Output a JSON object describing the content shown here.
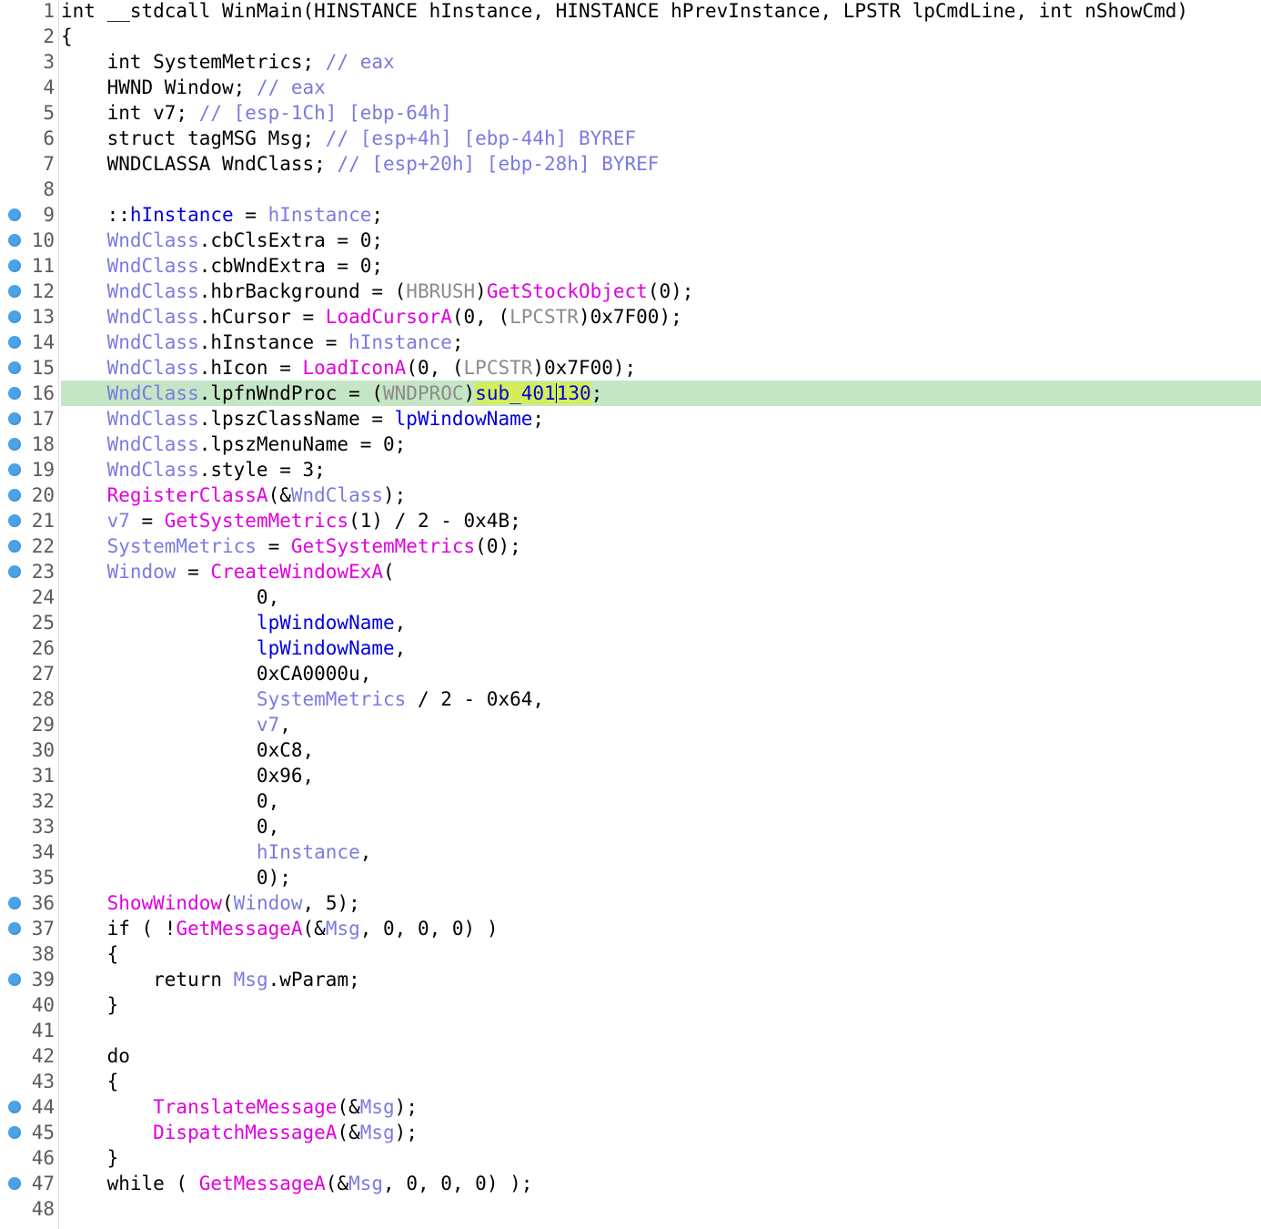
{
  "editor": {
    "view": "pseudocode",
    "highlighted_line": 16,
    "colors": {
      "highlight_line": "#c5e6c5",
      "selection": "#d4ee5a",
      "breakpoint": "#4aa3e8",
      "function": "#e000e0",
      "global": "#0000e0",
      "local": "#7b7be0",
      "type": "#8b8b8b",
      "comment": "#7a7adf"
    }
  },
  "lines": [
    {
      "n": "1",
      "bp": false,
      "hl": false,
      "tokens": [
        [
          "k",
          "int __stdcall WinMain(HINSTANCE hInstance, HINSTANCE hPrevInstance, LPSTR lpCmdLine, int nShowCmd)"
        ]
      ]
    },
    {
      "n": "2",
      "bp": false,
      "hl": false,
      "tokens": [
        [
          "p",
          "{"
        ]
      ]
    },
    {
      "n": "3",
      "bp": false,
      "hl": false,
      "tokens": [
        [
          "k",
          "    int SystemMetrics; "
        ],
        [
          "c",
          "// eax"
        ]
      ]
    },
    {
      "n": "4",
      "bp": false,
      "hl": false,
      "tokens": [
        [
          "k",
          "    HWND Window; "
        ],
        [
          "c",
          "// eax"
        ]
      ]
    },
    {
      "n": "5",
      "bp": false,
      "hl": false,
      "tokens": [
        [
          "k",
          "    int v7; "
        ],
        [
          "c",
          "// [esp-1Ch] [ebp-64h]"
        ]
      ]
    },
    {
      "n": "6",
      "bp": false,
      "hl": false,
      "tokens": [
        [
          "k",
          "    struct tagMSG Msg; "
        ],
        [
          "c",
          "// [esp+4h] [ebp-44h] BYREF"
        ]
      ]
    },
    {
      "n": "7",
      "bp": false,
      "hl": false,
      "tokens": [
        [
          "k",
          "    WNDCLASSA WndClass; "
        ],
        [
          "c",
          "// [esp+20h] [ebp-28h] BYREF"
        ]
      ]
    },
    {
      "n": "8",
      "bp": false,
      "hl": false,
      "tokens": []
    },
    {
      "n": "9",
      "bp": true,
      "hl": false,
      "tokens": [
        [
          "p",
          "    ::"
        ],
        [
          "g",
          "hInstance"
        ],
        [
          "p",
          " = "
        ],
        [
          "v",
          "hInstance"
        ],
        [
          "p",
          ";"
        ]
      ]
    },
    {
      "n": "10",
      "bp": true,
      "hl": false,
      "tokens": [
        [
          "v",
          "    WndClass"
        ],
        [
          "p",
          ".cbClsExtra = 0;"
        ]
      ]
    },
    {
      "n": "11",
      "bp": true,
      "hl": false,
      "tokens": [
        [
          "v",
          "    WndClass"
        ],
        [
          "p",
          ".cbWndExtra = 0;"
        ]
      ]
    },
    {
      "n": "12",
      "bp": true,
      "hl": false,
      "tokens": [
        [
          "v",
          "    WndClass"
        ],
        [
          "p",
          ".hbrBackground = ("
        ],
        [
          "t",
          "HBRUSH"
        ],
        [
          "p",
          ")"
        ],
        [
          "f",
          "GetStockObject"
        ],
        [
          "p",
          "(0);"
        ]
      ]
    },
    {
      "n": "13",
      "bp": true,
      "hl": false,
      "tokens": [
        [
          "v",
          "    WndClass"
        ],
        [
          "p",
          ".hCursor = "
        ],
        [
          "f",
          "LoadCursorA"
        ],
        [
          "p",
          "(0, ("
        ],
        [
          "t",
          "LPCSTR"
        ],
        [
          "p",
          ")0x7F00);"
        ]
      ]
    },
    {
      "n": "14",
      "bp": true,
      "hl": false,
      "tokens": [
        [
          "v",
          "    WndClass"
        ],
        [
          "p",
          ".hInstance = "
        ],
        [
          "v",
          "hInstance"
        ],
        [
          "p",
          ";"
        ]
      ]
    },
    {
      "n": "15",
      "bp": true,
      "hl": false,
      "tokens": [
        [
          "v",
          "    WndClass"
        ],
        [
          "p",
          ".hIcon = "
        ],
        [
          "f",
          "LoadIconA"
        ],
        [
          "p",
          "(0, ("
        ],
        [
          "t",
          "LPCSTR"
        ],
        [
          "p",
          ")0x7F00);"
        ]
      ]
    },
    {
      "n": "16",
      "bp": true,
      "hl": true,
      "tokens": [
        [
          "v",
          "    WndClass"
        ],
        [
          "p",
          ".lpfnWndProc = ("
        ],
        [
          "t",
          "WNDPROC"
        ],
        [
          "p",
          ")"
        ],
        [
          "gs",
          "sub_401"
        ],
        [
          "caret",
          ""
        ],
        [
          "gs",
          "130"
        ],
        [
          "p",
          ";"
        ]
      ]
    },
    {
      "n": "17",
      "bp": true,
      "hl": false,
      "tokens": [
        [
          "v",
          "    WndClass"
        ],
        [
          "p",
          ".lpszClassName = "
        ],
        [
          "g",
          "lpWindowName"
        ],
        [
          "p",
          ";"
        ]
      ]
    },
    {
      "n": "18",
      "bp": true,
      "hl": false,
      "tokens": [
        [
          "v",
          "    WndClass"
        ],
        [
          "p",
          ".lpszMenuName = 0;"
        ]
      ]
    },
    {
      "n": "19",
      "bp": true,
      "hl": false,
      "tokens": [
        [
          "v",
          "    WndClass"
        ],
        [
          "p",
          ".style = 3;"
        ]
      ]
    },
    {
      "n": "20",
      "bp": true,
      "hl": false,
      "tokens": [
        [
          "f",
          "    RegisterClassA"
        ],
        [
          "p",
          "(&"
        ],
        [
          "v",
          "WndClass"
        ],
        [
          "p",
          ");"
        ]
      ]
    },
    {
      "n": "21",
      "bp": true,
      "hl": false,
      "tokens": [
        [
          "v",
          "    v7"
        ],
        [
          "p",
          " = "
        ],
        [
          "f",
          "GetSystemMetrics"
        ],
        [
          "p",
          "(1) / 2 - 0x4B;"
        ]
      ]
    },
    {
      "n": "22",
      "bp": true,
      "hl": false,
      "tokens": [
        [
          "v",
          "    SystemMetrics"
        ],
        [
          "p",
          " = "
        ],
        [
          "f",
          "GetSystemMetrics"
        ],
        [
          "p",
          "(0);"
        ]
      ]
    },
    {
      "n": "23",
      "bp": true,
      "hl": false,
      "tokens": [
        [
          "v",
          "    Window"
        ],
        [
          "p",
          " = "
        ],
        [
          "f",
          "CreateWindowExA"
        ],
        [
          "p",
          "("
        ]
      ]
    },
    {
      "n": "24",
      "bp": false,
      "hl": false,
      "tokens": [
        [
          "p",
          "                 0,"
        ]
      ]
    },
    {
      "n": "25",
      "bp": false,
      "hl": false,
      "tokens": [
        [
          "g",
          "                 lpWindowName"
        ],
        [
          "p",
          ","
        ]
      ]
    },
    {
      "n": "26",
      "bp": false,
      "hl": false,
      "tokens": [
        [
          "g",
          "                 lpWindowName"
        ],
        [
          "p",
          ","
        ]
      ]
    },
    {
      "n": "27",
      "bp": false,
      "hl": false,
      "tokens": [
        [
          "p",
          "                 0xCA0000u,"
        ]
      ]
    },
    {
      "n": "28",
      "bp": false,
      "hl": false,
      "tokens": [
        [
          "v",
          "                 SystemMetrics"
        ],
        [
          "p",
          " / 2 - 0x64,"
        ]
      ]
    },
    {
      "n": "29",
      "bp": false,
      "hl": false,
      "tokens": [
        [
          "v",
          "                 v7"
        ],
        [
          "p",
          ","
        ]
      ]
    },
    {
      "n": "30",
      "bp": false,
      "hl": false,
      "tokens": [
        [
          "p",
          "                 0xC8,"
        ]
      ]
    },
    {
      "n": "31",
      "bp": false,
      "hl": false,
      "tokens": [
        [
          "p",
          "                 0x96,"
        ]
      ]
    },
    {
      "n": "32",
      "bp": false,
      "hl": false,
      "tokens": [
        [
          "p",
          "                 0,"
        ]
      ]
    },
    {
      "n": "33",
      "bp": false,
      "hl": false,
      "tokens": [
        [
          "p",
          "                 0,"
        ]
      ]
    },
    {
      "n": "34",
      "bp": false,
      "hl": false,
      "tokens": [
        [
          "v",
          "                 hInstance"
        ],
        [
          "p",
          ","
        ]
      ]
    },
    {
      "n": "35",
      "bp": false,
      "hl": false,
      "tokens": [
        [
          "p",
          "                 0);"
        ]
      ]
    },
    {
      "n": "36",
      "bp": true,
      "hl": false,
      "tokens": [
        [
          "f",
          "    ShowWindow"
        ],
        [
          "p",
          "("
        ],
        [
          "v",
          "Window"
        ],
        [
          "p",
          ", 5);"
        ]
      ]
    },
    {
      "n": "37",
      "bp": true,
      "hl": false,
      "tokens": [
        [
          "p",
          "    if ( !"
        ],
        [
          "f",
          "GetMessageA"
        ],
        [
          "p",
          "(&"
        ],
        [
          "v",
          "Msg"
        ],
        [
          "p",
          ", 0, 0, 0) )"
        ]
      ]
    },
    {
      "n": "38",
      "bp": false,
      "hl": false,
      "tokens": [
        [
          "p",
          "    {"
        ]
      ]
    },
    {
      "n": "39",
      "bp": true,
      "hl": false,
      "tokens": [
        [
          "p",
          "        return "
        ],
        [
          "v",
          "Msg"
        ],
        [
          "p",
          ".wParam;"
        ]
      ]
    },
    {
      "n": "40",
      "bp": false,
      "hl": false,
      "tokens": [
        [
          "p",
          "    }"
        ]
      ]
    },
    {
      "n": "41",
      "bp": false,
      "hl": false,
      "tokens": []
    },
    {
      "n": "42",
      "bp": false,
      "hl": false,
      "tokens": [
        [
          "p",
          "    do"
        ]
      ]
    },
    {
      "n": "43",
      "bp": false,
      "hl": false,
      "tokens": [
        [
          "p",
          "    {"
        ]
      ]
    },
    {
      "n": "44",
      "bp": true,
      "hl": false,
      "tokens": [
        [
          "f",
          "        TranslateMessage"
        ],
        [
          "p",
          "(&"
        ],
        [
          "v",
          "Msg"
        ],
        [
          "p",
          ");"
        ]
      ]
    },
    {
      "n": "45",
      "bp": true,
      "hl": false,
      "tokens": [
        [
          "f",
          "        DispatchMessageA"
        ],
        [
          "p",
          "(&"
        ],
        [
          "v",
          "Msg"
        ],
        [
          "p",
          ");"
        ]
      ]
    },
    {
      "n": "46",
      "bp": false,
      "hl": false,
      "tokens": [
        [
          "p",
          "    }"
        ]
      ]
    },
    {
      "n": "47",
      "bp": true,
      "hl": false,
      "tokens": [
        [
          "p",
          "    while ( "
        ],
        [
          "f",
          "GetMessageA"
        ],
        [
          "p",
          "(&"
        ],
        [
          "v",
          "Msg"
        ],
        [
          "p",
          ", 0, 0, 0) );"
        ]
      ]
    },
    {
      "n": "48",
      "bp": false,
      "hl": false,
      "tokens": []
    }
  ]
}
